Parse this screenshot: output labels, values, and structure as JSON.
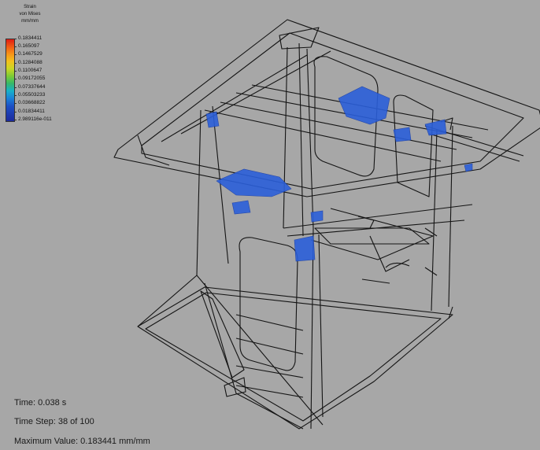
{
  "legend": {
    "title_line1": "Strain",
    "title_line2": "von Mises",
    "unit": "mm/mm",
    "values": [
      "0.1834411",
      "0.165097",
      "0.1467529",
      "0.1284088",
      "0.1100647",
      "0.09172055",
      "0.07337644",
      "0.05503233",
      "0.03668822",
      "0.01834411",
      "2.989116e-011"
    ]
  },
  "status": {
    "time_label": "Time:",
    "time_value": "0.038 s",
    "step_label": "Time Step:",
    "step_value": "38 of 100",
    "max_label": "Maximum Value:",
    "max_value": "0.183441 mm/mm"
  },
  "colors": {
    "background": "#a7a7a7",
    "wireframe": "#111111",
    "strain_low_blue": "#2b5fd9",
    "strain_hot": "#3a72e6"
  }
}
